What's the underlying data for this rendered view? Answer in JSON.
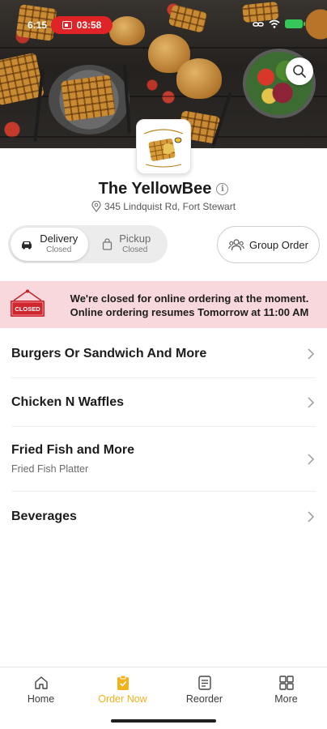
{
  "status_bar": {
    "time": "6:15",
    "recording_timer": "03:58",
    "battery_color": "#35c759"
  },
  "header": {
    "search_icon": "search-icon"
  },
  "restaurant": {
    "name": "The YellowBee",
    "address": "345 Lindquist Rd, Fort Stewart"
  },
  "order_mode": {
    "delivery": {
      "label": "Delivery",
      "status": "Closed",
      "icon": "car-icon"
    },
    "pickup": {
      "label": "Pickup",
      "status": "Closed",
      "icon": "bag-icon"
    },
    "group_order_label": "Group Order"
  },
  "closed_banner": {
    "sign_text": "CLOSED",
    "line1": "We're closed for online ordering at the moment.",
    "line2": "Online ordering resumes Tomorrow at 11:00 AM",
    "background": "#f8d8dc"
  },
  "categories": [
    {
      "name": "Burgers Or Sandwich And More",
      "subtitle": ""
    },
    {
      "name": "Chicken N Waffles",
      "subtitle": ""
    },
    {
      "name": "Fried Fish and More",
      "subtitle": "Fried Fish Platter"
    },
    {
      "name": "Beverages",
      "subtitle": ""
    }
  ],
  "bottom_nav": {
    "active_color": "#f2b21b",
    "items": [
      {
        "label": "Home",
        "icon": "home-icon"
      },
      {
        "label": "Order Now",
        "icon": "order-icon"
      },
      {
        "label": "Reorder",
        "icon": "receipt-icon"
      },
      {
        "label": "More",
        "icon": "grid-icon"
      }
    ]
  }
}
